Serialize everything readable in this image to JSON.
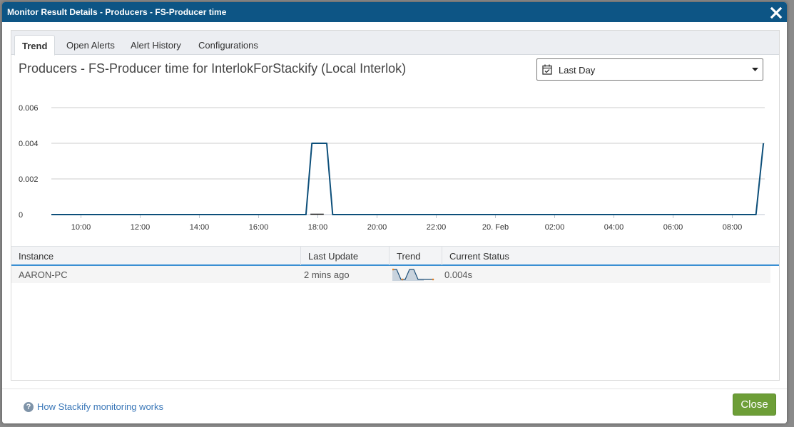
{
  "window": {
    "title": "Monitor Result Details - Producers - FS-Producer time"
  },
  "tabs": [
    {
      "label": "Trend",
      "active": true
    },
    {
      "label": "Open Alerts",
      "active": false
    },
    {
      "label": "Alert History",
      "active": false
    },
    {
      "label": "Configurations",
      "active": false
    }
  ],
  "chart_header": {
    "title": "Producers - FS-Producer time for InterlokForStackify (Local Interlok)"
  },
  "range_select": {
    "value": "Last Day",
    "icon": "calendar-icon"
  },
  "chart_data": {
    "type": "line",
    "title": "",
    "xlabel": "",
    "ylabel": "",
    "x_tick_labels": [
      "10:00",
      "12:00",
      "14:00",
      "16:00",
      "18:00",
      "20:00",
      "22:00",
      "20. Feb",
      "02:00",
      "04:00",
      "06:00",
      "08:00"
    ],
    "y_tick_labels": [
      "0.006",
      "0.004",
      "0.002",
      "0"
    ],
    "ylim": [
      0,
      0.006
    ],
    "grid": true,
    "x_unit": "hours since 10:00",
    "series": [
      {
        "color": "#0d4f7a",
        "points": [
          {
            "x": -1.0,
            "y": 0
          },
          {
            "x": 7.6,
            "y": 0
          },
          {
            "x": 7.8,
            "y": 0.004
          },
          {
            "x": 8.3,
            "y": 0.004
          },
          {
            "x": 8.5,
            "y": 0
          },
          {
            "x": 22.8,
            "y": 0
          },
          {
            "x": 23.05,
            "y": 0.004
          }
        ]
      }
    ]
  },
  "table": {
    "columns": [
      "Instance",
      "Last Update",
      "Trend",
      "Current Status"
    ],
    "rows": [
      {
        "instance": "AARON-PC",
        "last_update": "2 mins ago",
        "current_status": "0.004s"
      }
    ]
  },
  "footer": {
    "help_link": "How Stackify monitoring works",
    "close_label": "Close"
  },
  "colors": {
    "titlebar": "#0d5585",
    "line": "#0d4f7a",
    "close_button": "#6d9e37",
    "link": "#3a77b8"
  }
}
